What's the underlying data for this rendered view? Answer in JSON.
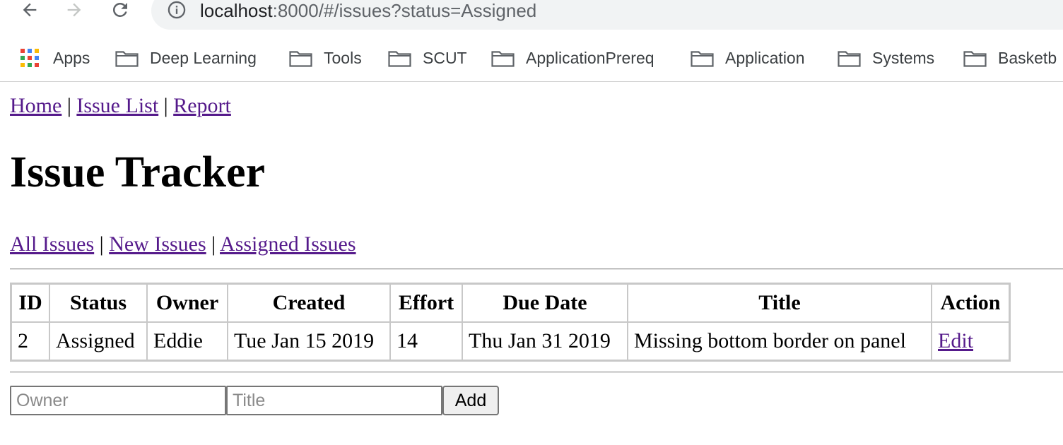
{
  "browser": {
    "url_host": "localhost",
    "url_rest": ":8000/#/issues?status=Assigned",
    "bookmarks": [
      {
        "label": "Apps",
        "icon": "apps-grid-icon"
      },
      {
        "label": "Deep Learning",
        "icon": "folder-icon"
      },
      {
        "label": "Tools",
        "icon": "folder-icon"
      },
      {
        "label": "SCUT",
        "icon": "folder-icon"
      },
      {
        "label": "ApplicationPrereq",
        "icon": "folder-icon"
      },
      {
        "label": "Application",
        "icon": "folder-icon"
      },
      {
        "label": "Systems",
        "icon": "folder-icon"
      },
      {
        "label": "Basketb",
        "icon": "folder-icon"
      }
    ]
  },
  "top_nav": {
    "home": "Home",
    "issue_list": "Issue List",
    "report": "Report",
    "separator": "|"
  },
  "page_title": "Issue Tracker",
  "filters": {
    "all": "All Issues",
    "new": "New Issues",
    "assigned": "Assigned Issues",
    "separator": "|"
  },
  "table": {
    "headers": [
      "ID",
      "Status",
      "Owner",
      "Created",
      "Effort",
      "Due Date",
      "Title",
      "Action"
    ],
    "rows": [
      {
        "id": "2",
        "status": "Assigned",
        "owner": "Eddie",
        "created": "Tue Jan 15 2019",
        "effort": "14",
        "due": "Thu Jan 31 2019",
        "title": "Missing bottom border on panel",
        "action": "Edit"
      }
    ]
  },
  "add_form": {
    "owner_placeholder": "Owner",
    "title_placeholder": "Title",
    "add_label": "Add"
  },
  "colors": {
    "link": "#551a8b",
    "omnibox_bg": "#f1f3f4"
  }
}
